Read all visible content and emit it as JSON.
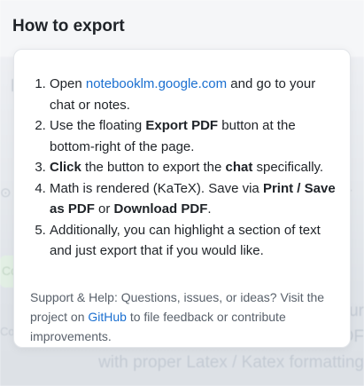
{
  "header": {
    "title": "How to export"
  },
  "steps": [
    {
      "pre": "Open ",
      "link": "notebooklm.google.com",
      "post": " and go to your chat or notes."
    },
    {
      "pre": "Use the floating ",
      "bold": "Export PDF",
      "post": " button at the bottom-right of the page."
    },
    {
      "bold1": "Click",
      "mid": " the button to export the ",
      "bold2": "chat",
      "post": " specifically."
    },
    {
      "pre": "Math is rendered (KaTeX). Save via ",
      "bold1": "Print / Save as PDF",
      "mid": " or ",
      "bold2": "Download PDF",
      "post": "."
    },
    {
      "text": "Additionally, you can highlight a section of text and just export that if you would like."
    }
  ],
  "footer": {
    "pre": "Support & Help: Questions, issues, or ideas? Visit the project on ",
    "link": "GitHub",
    "post": " to file feedback or contribute improvements."
  },
  "colors": {
    "link": "#1a6fd0",
    "text": "#1f2328",
    "muted": "#59616b"
  }
}
